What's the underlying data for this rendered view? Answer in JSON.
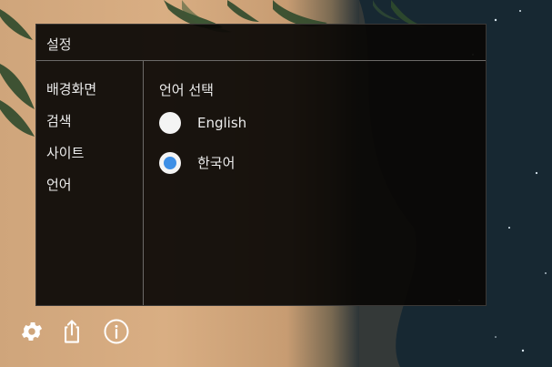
{
  "settings": {
    "title": "설정",
    "sidebar": {
      "items": [
        {
          "label": "배경화면"
        },
        {
          "label": "검색"
        },
        {
          "label": "사이트"
        },
        {
          "label": "언어"
        }
      ]
    },
    "language": {
      "section_title": "언어 선택",
      "options": [
        {
          "label": "English",
          "selected": false
        },
        {
          "label": "한국어",
          "selected": true
        }
      ]
    }
  },
  "toolbar": {
    "icons": [
      "gear-icon",
      "share-icon",
      "info-icon"
    ]
  },
  "colors": {
    "radio_selected": "#3d8fe6",
    "panel_background": "#0a0705"
  }
}
